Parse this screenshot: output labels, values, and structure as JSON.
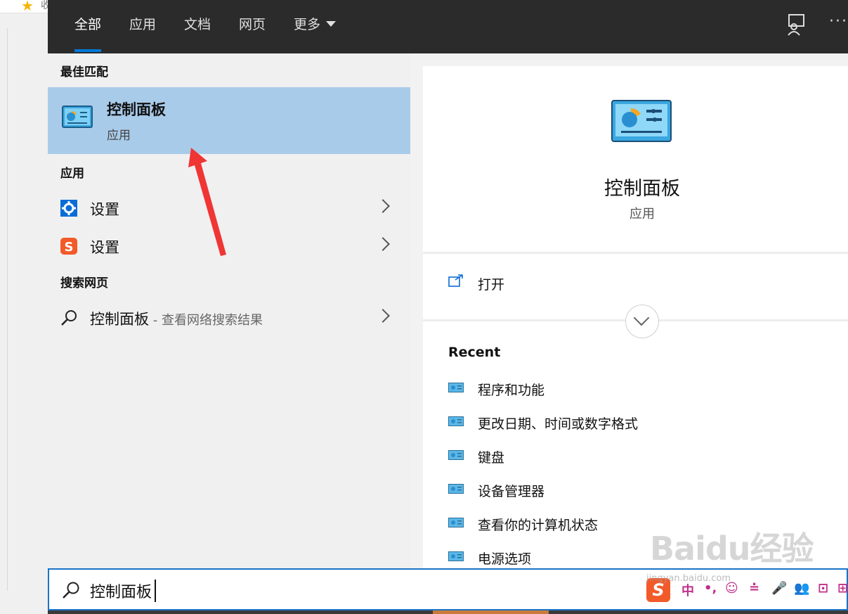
{
  "tabs": [
    {
      "label": "全部",
      "active": true
    },
    {
      "label": "应用",
      "active": false
    },
    {
      "label": "文档",
      "active": false
    },
    {
      "label": "网页",
      "active": false
    },
    {
      "label": "更多",
      "active": false
    }
  ],
  "sections": {
    "best_match": "最佳匹配",
    "apps": "应用",
    "web": "搜索网页"
  },
  "best_match": {
    "title": "控制面板",
    "subtitle": "应用",
    "icon": "control-panel-icon"
  },
  "apps": [
    {
      "label": "设置",
      "icon": "settings-gear-icon"
    },
    {
      "label": "设置",
      "icon": "sogou-s-icon"
    }
  ],
  "web": {
    "label": "控制面板",
    "suffix": " - 查看网络搜索结果",
    "icon": "search-icon"
  },
  "detail": {
    "title": "控制面板",
    "subtitle": "应用",
    "open_label": "打开",
    "recent_header": "Recent",
    "recent": [
      "程序和功能",
      "更改日期、时间或数字格式",
      "键盘",
      "设备管理器",
      "查看你的计算机状态",
      "电源选项"
    ]
  },
  "search": {
    "value": "控制面板"
  },
  "watermark": {
    "text": "Baidu经验",
    "sub": "jingyan.baidu.com"
  },
  "ime": {
    "logo": "S",
    "items": [
      "中",
      "•,",
      "☺",
      "≐",
      "🎤",
      "👥",
      "⊡",
      "⊞"
    ]
  },
  "colors": {
    "accent": "#0078d7",
    "selection": "#a9cbea",
    "topbar": "#2b2b2b"
  }
}
